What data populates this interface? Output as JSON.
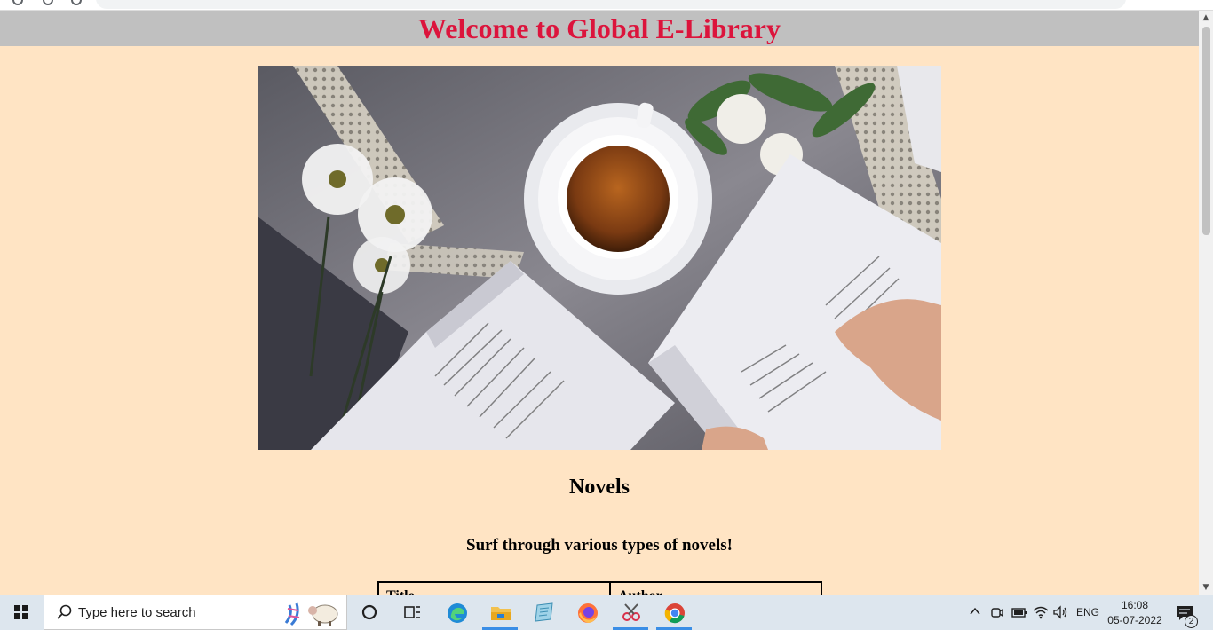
{
  "page": {
    "site_title": "Welcome to Global E-Library",
    "hero_image": "books-and-tea-photo",
    "section_heading": "Novels",
    "section_subheading": "Surf through various types of novels!",
    "table_headers": [
      "Title",
      "Author"
    ]
  },
  "taskbar": {
    "search_placeholder": "Type here to search",
    "pinned_apps": [
      "cortana",
      "task-view",
      "edge",
      "file-explorer",
      "notepad",
      "firefox",
      "snipping-tool",
      "chrome"
    ],
    "active_apps": [
      "file-explorer",
      "snipping-tool",
      "chrome"
    ],
    "tray": {
      "language": "ENG",
      "time": "16:08",
      "date": "05-07-2022",
      "notification_count": "2"
    }
  },
  "colors": {
    "page_background": "#ffe4c4",
    "header_background": "#c0c0c0",
    "title_color": "#dc143c",
    "taskbar_background": "#dde6ee"
  }
}
